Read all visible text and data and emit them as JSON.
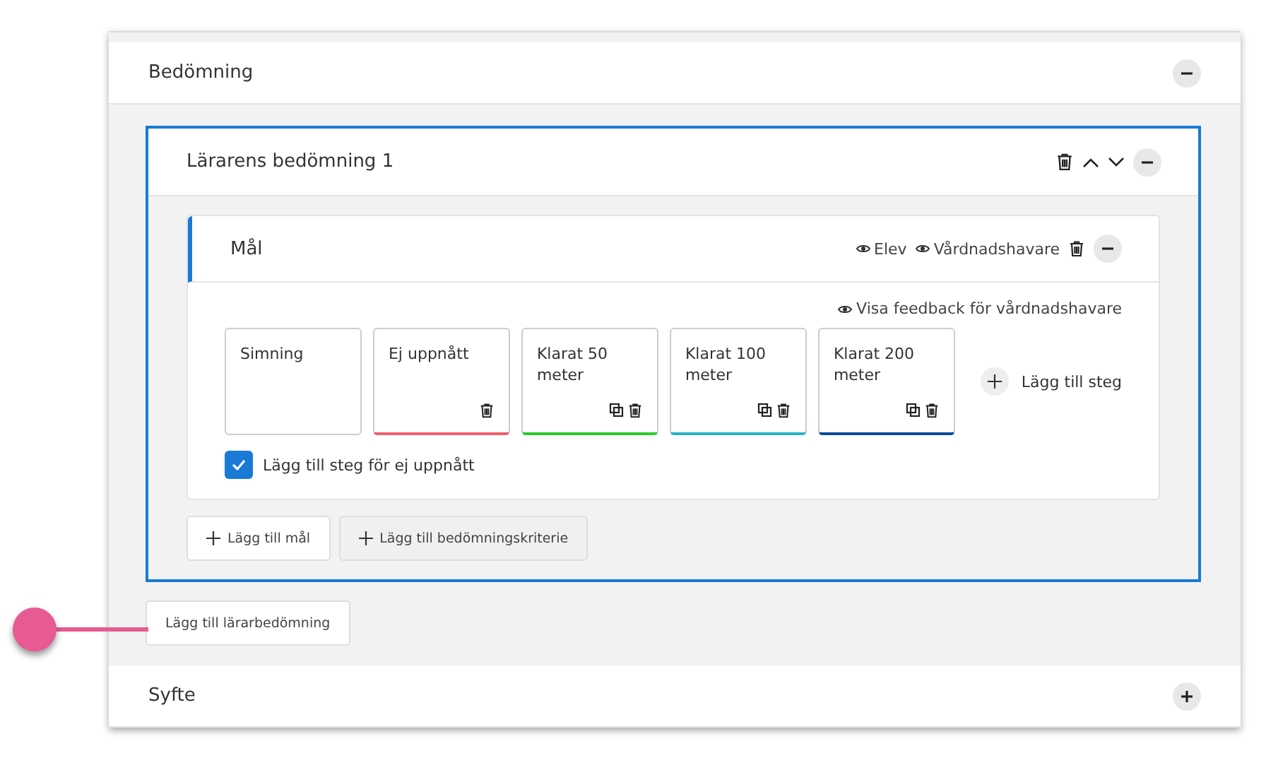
{
  "sections": [
    {
      "title": "Bedömning",
      "expanded": true
    },
    {
      "title": "Syfte",
      "expanded": false
    }
  ],
  "assessment": {
    "title": "Lärarens bedömning 1",
    "expanded": true,
    "goal": {
      "title": "Mål",
      "expanded": true,
      "visibility": [
        "Elev",
        "Vårdnadshavare"
      ],
      "feedback_link": "Visa feedback för vårdnadshavare",
      "steps": [
        {
          "kind": "goal",
          "label": "Simning"
        },
        {
          "kind": "step",
          "label": "Ej uppnått",
          "color": "#f0606c",
          "copyable": false
        },
        {
          "kind": "step",
          "label": "Klarat 50 meter",
          "color": "#2ec92e",
          "copyable": true
        },
        {
          "kind": "step",
          "label": "Klarat 100 meter",
          "color": "#27b3c4",
          "copyable": true
        },
        {
          "kind": "step",
          "label": "Klarat 200 meter",
          "color": "#0d4a9c",
          "copyable": true
        }
      ],
      "add_step": "Lägg till steg",
      "not_reached_option": {
        "label": "Lägg till steg för ej uppnått",
        "checked": true
      }
    },
    "buttons": [
      "Lägg till mål",
      "Lägg till bedömningskriterie"
    ]
  },
  "add_assessment_button": "Lägg till lärarbedömning"
}
